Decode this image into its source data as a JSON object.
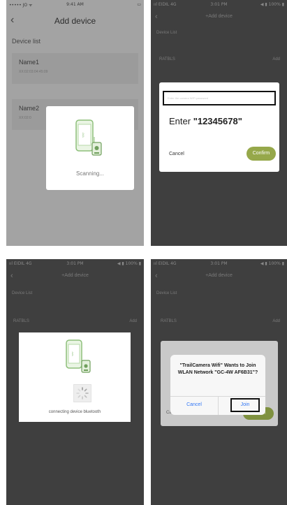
{
  "panel1": {
    "status": {
      "carrier": "••••• JO ᯤ",
      "time": "9:41 AM"
    },
    "title": "Add device",
    "section": "Device list",
    "devices": [
      {
        "name": "Name1",
        "mac": "XX:02:03:04:45:09"
      },
      {
        "name": "Name2",
        "mac": "XX:02:0"
      }
    ],
    "scanning_label": "Scanning..."
  },
  "panel2": {
    "status": {
      "carrier": "ııl EIDIL 4G",
      "time": "3:01 PM",
      "right": "◀ ▮ 100% ▮"
    },
    "title": "+Add device",
    "section": "Device List",
    "device_name": "RATBLS",
    "add_label": "Add",
    "input_placeholder": "Enter the camera WiFi password",
    "instruction_prefix": "Enter ",
    "instruction_value": "\"12345678\"",
    "cancel_label": "Cancel",
    "confirm_label": "Confirm"
  },
  "panel3": {
    "status": {
      "carrier": "ııl EIDIL 4G",
      "time": "3:01 PM",
      "right": "◀ ▮ 100% ▮"
    },
    "title": "+Add device",
    "section": "Device List",
    "device_name": "RATBLS",
    "add_label": "Add",
    "connecting_label": "connecting device bluetooth"
  },
  "panel4": {
    "status": {
      "carrier": "ııl EIDIL 4G",
      "time": "3:01 PM",
      "right": "◀ ▮ 100% ▮"
    },
    "title": "+Add device",
    "section": "Device List",
    "device_name": "RATBLS",
    "add_label": "Add",
    "alert_message": "\"TrailCamera Wifi\" Wants to Join WLAN Network \"GC-4W AF6B31\"?",
    "alert_cancel": "Cancel",
    "alert_join": "Join",
    "under_cancel": "Cancel",
    "under_confirm": "Confirm"
  },
  "colors": {
    "confirm_green": "#96a84a",
    "ios_blue": "#3478f6",
    "dark_bg": "#3f3f3f"
  }
}
